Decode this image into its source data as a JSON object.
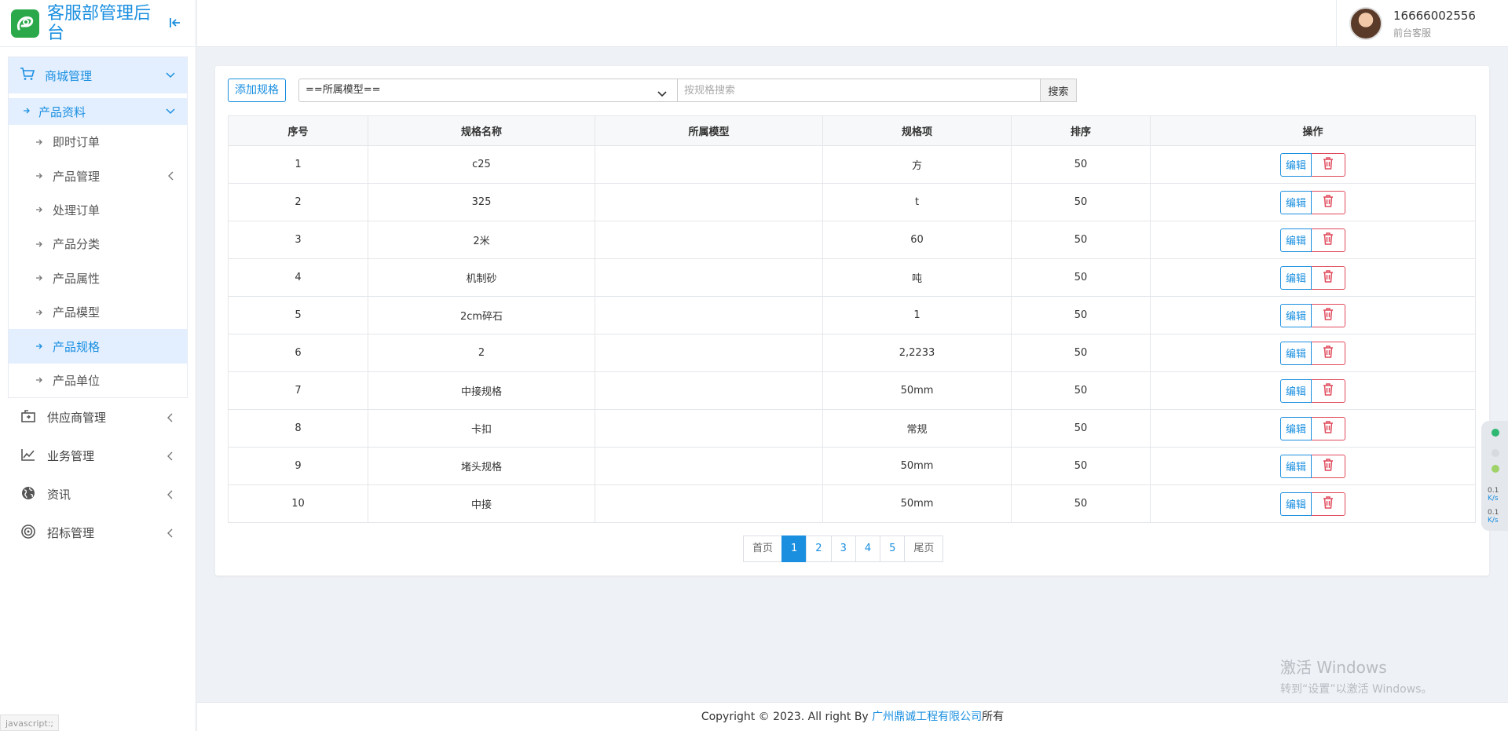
{
  "app": {
    "title": "客服部管理后台"
  },
  "user": {
    "phone": "16666002556",
    "role": "前台客服"
  },
  "sidebar": {
    "mall": {
      "label": "商城管理"
    },
    "product_info": {
      "label": "产品资料"
    },
    "sub_items": [
      {
        "label": "即时订单"
      },
      {
        "label": "产品管理"
      },
      {
        "label": "处理订单"
      },
      {
        "label": "产品分类"
      },
      {
        "label": "产品属性"
      },
      {
        "label": "产品模型"
      },
      {
        "label": "产品规格"
      },
      {
        "label": "产品单位"
      }
    ],
    "groups": [
      {
        "label": "供应商管理"
      },
      {
        "label": "业务管理"
      },
      {
        "label": "资讯"
      },
      {
        "label": "招标管理"
      }
    ]
  },
  "toolbar": {
    "add_label": "添加规格",
    "model_select_value": "==所属模型==",
    "search_placeholder": "按规格搜索",
    "search_label": "搜索"
  },
  "table": {
    "headers": [
      "序号",
      "规格名称",
      "所属模型",
      "规格项",
      "排序",
      "操作"
    ],
    "edit_label": "编辑",
    "rows": [
      {
        "no": "1",
        "name": "c25",
        "model": "",
        "item": "方",
        "sort": "50"
      },
      {
        "no": "2",
        "name": "325",
        "model": "",
        "item": "t",
        "sort": "50"
      },
      {
        "no": "3",
        "name": "2米",
        "model": "",
        "item": "60",
        "sort": "50"
      },
      {
        "no": "4",
        "name": "机制砂",
        "model": "",
        "item": "吨",
        "sort": "50"
      },
      {
        "no": "5",
        "name": "2cm碎石",
        "model": "",
        "item": "1",
        "sort": "50"
      },
      {
        "no": "6",
        "name": "2",
        "model": "",
        "item": "2,2233",
        "sort": "50"
      },
      {
        "no": "7",
        "name": "中接规格",
        "model": "",
        "item": "50mm",
        "sort": "50"
      },
      {
        "no": "8",
        "name": "卡扣",
        "model": "",
        "item": "常规",
        "sort": "50"
      },
      {
        "no": "9",
        "name": "堵头规格",
        "model": "",
        "item": "50mm",
        "sort": "50"
      },
      {
        "no": "10",
        "name": "中接",
        "model": "",
        "item": "50mm",
        "sort": "50"
      }
    ]
  },
  "pagination": {
    "first": "首页",
    "pages": [
      "1",
      "2",
      "3",
      "4",
      "5"
    ],
    "current": "1",
    "last": "尾页"
  },
  "footer": {
    "prefix": "Copyright © 2023. All right By ",
    "company": "广州鼎诚工程有限公司",
    "suffix": "所有"
  },
  "watermark": {
    "line1": "激活 Windows",
    "line2": "转到“设置”以激活 Windows。"
  },
  "net_widget": {
    "up": "0.1",
    "up_unit": "K/s",
    "down": "0.1",
    "down_unit": "K/s"
  },
  "status_bar": {
    "text": "javascript:;"
  },
  "colors": {
    "accent": "#1a8fe0",
    "danger": "#e04a5c",
    "logo": "#2aa84a",
    "active_bg": "#e3efff"
  }
}
